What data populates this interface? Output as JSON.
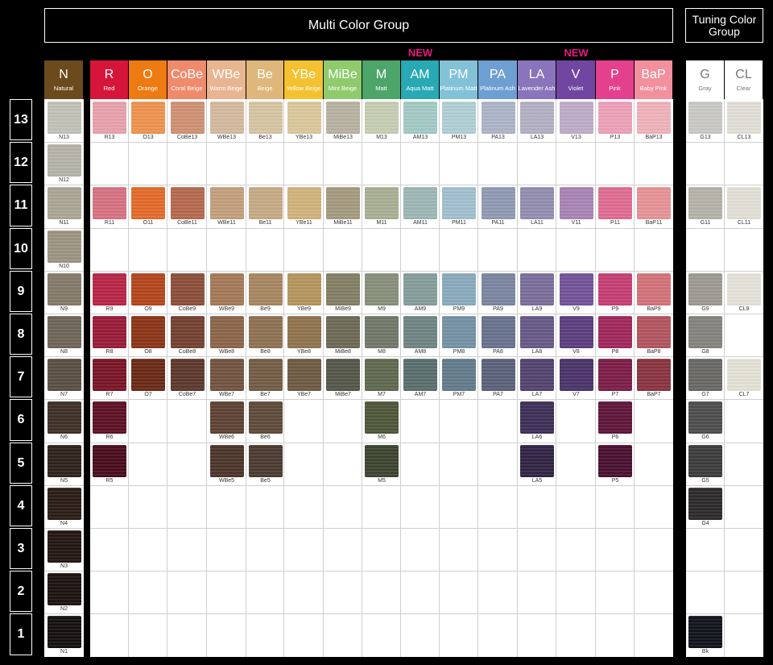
{
  "headers": {
    "multi_group": "Multi Color Group",
    "tuning_group": "Tuning Color Group",
    "new_label": "NEW"
  },
  "levels": [
    "13",
    "12",
    "11",
    "10",
    "9",
    "8",
    "7",
    "6",
    "5",
    "4",
    "3",
    "2",
    "1"
  ],
  "columns": [
    {
      "abbr": "N",
      "name": "Natural",
      "bg": "#6b4a1c"
    },
    {
      "abbr": "R",
      "name": "Red",
      "bg": "#d6153b"
    },
    {
      "abbr": "O",
      "name": "Orange",
      "bg": "#ee7a12"
    },
    {
      "abbr": "CoBe",
      "name": "Coral Beige",
      "bg": "#f08a6c"
    },
    {
      "abbr": "WBe",
      "name": "Warm Beige",
      "bg": "#e8b591"
    },
    {
      "abbr": "Be",
      "name": "Beige",
      "bg": "#dfb77a"
    },
    {
      "abbr": "YBe",
      "name": "Yellow Beige",
      "bg": "#f4c230"
    },
    {
      "abbr": "MiBe",
      "name": "Mint Beige",
      "bg": "#8fcb6c"
    },
    {
      "abbr": "M",
      "name": "Matt",
      "bg": "#4ea56a"
    },
    {
      "abbr": "AM",
      "name": "Aqua Matt",
      "bg": "#28a9b4"
    },
    {
      "abbr": "PM",
      "name": "Platinum Matt",
      "bg": "#83c2d6"
    },
    {
      "abbr": "PA",
      "name": "Platinum Ash",
      "bg": "#6e9fd2"
    },
    {
      "abbr": "LA",
      "name": "Lavender Ash",
      "bg": "#8a74bb"
    },
    {
      "abbr": "V",
      "name": "Violet",
      "bg": "#7046a1"
    },
    {
      "abbr": "P",
      "name": "Pink",
      "bg": "#e5408d"
    },
    {
      "abbr": "BaP",
      "name": "Baby Pink",
      "bg": "#f2909d"
    },
    {
      "abbr": "G",
      "name": "Gray",
      "bg": "#ffffff"
    },
    {
      "abbr": "CL",
      "name": "Clear",
      "bg": "#ffffff"
    }
  ],
  "new_columns": [
    "AM",
    "V"
  ],
  "swatches": [
    {
      "code": "N13",
      "col": 0,
      "row": 0,
      "color": "#c3c2b8"
    },
    {
      "code": "N12",
      "col": 0,
      "row": 1,
      "color": "#b6b5aa"
    },
    {
      "code": "N11",
      "col": 0,
      "row": 2,
      "color": "#aca695"
    },
    {
      "code": "N10",
      "col": 0,
      "row": 3,
      "color": "#9e9582"
    },
    {
      "code": "N9",
      "col": 0,
      "row": 4,
      "color": "#857b6b"
    },
    {
      "code": "N8",
      "col": 0,
      "row": 5,
      "color": "#6f6558"
    },
    {
      "code": "N7",
      "col": 0,
      "row": 6,
      "color": "#5b4f42"
    },
    {
      "code": "N6",
      "col": 0,
      "row": 7,
      "color": "#3e3026"
    },
    {
      "code": "N5",
      "col": 0,
      "row": 8,
      "color": "#2f231b"
    },
    {
      "code": "N4",
      "col": 0,
      "row": 9,
      "color": "#2a1c16"
    },
    {
      "code": "N3",
      "col": 0,
      "row": 10,
      "color": "#221612"
    },
    {
      "code": "N2",
      "col": 0,
      "row": 11,
      "color": "#1c1210"
    },
    {
      "code": "N1",
      "col": 0,
      "row": 12,
      "color": "#141010"
    },
    {
      "code": "R13",
      "col": 1,
      "row": 0,
      "color": "#e9a3ad"
    },
    {
      "code": "R11",
      "col": 1,
      "row": 2,
      "color": "#d87382"
    },
    {
      "code": "R9",
      "col": 1,
      "row": 4,
      "color": "#b82546"
    },
    {
      "code": "R8",
      "col": 1,
      "row": 5,
      "color": "#9a1b38"
    },
    {
      "code": "R7",
      "col": 1,
      "row": 6,
      "color": "#7a1526"
    },
    {
      "code": "R6",
      "col": 1,
      "row": 7,
      "color": "#5e1024"
    },
    {
      "code": "R5",
      "col": 1,
      "row": 8,
      "color": "#4a0c1c"
    },
    {
      "code": "O13",
      "col": 2,
      "row": 0,
      "color": "#f0944f"
    },
    {
      "code": "O11",
      "col": 2,
      "row": 2,
      "color": "#e56b2b"
    },
    {
      "code": "O9",
      "col": 2,
      "row": 4,
      "color": "#b5461c"
    },
    {
      "code": "O8",
      "col": 2,
      "row": 5,
      "color": "#8c3516"
    },
    {
      "code": "O7",
      "col": 2,
      "row": 6,
      "color": "#6a2a16"
    },
    {
      "code": "CoBe13",
      "col": 3,
      "row": 0,
      "color": "#d09275"
    },
    {
      "code": "CoBe11",
      "col": 3,
      "row": 2,
      "color": "#b66a4f"
    },
    {
      "code": "CoBe9",
      "col": 3,
      "row": 4,
      "color": "#8c4f3a"
    },
    {
      "code": "CoBe8",
      "col": 3,
      "row": 5,
      "color": "#744131"
    },
    {
      "code": "CoBe7",
      "col": 3,
      "row": 6,
      "color": "#5e382d"
    },
    {
      "code": "WBe13",
      "col": 4,
      "row": 0,
      "color": "#d5bb9f"
    },
    {
      "code": "WBe11",
      "col": 4,
      "row": 2,
      "color": "#c5a07d"
    },
    {
      "code": "WBe9",
      "col": 4,
      "row": 4,
      "color": "#a57a58"
    },
    {
      "code": "WBe8",
      "col": 4,
      "row": 5,
      "color": "#8c6549"
    },
    {
      "code": "WBe7",
      "col": 4,
      "row": 6,
      "color": "#735440"
    },
    {
      "code": "WBe6",
      "col": 4,
      "row": 7,
      "color": "#5e4233"
    },
    {
      "code": "WBe5",
      "col": 4,
      "row": 8,
      "color": "#4c352b"
    },
    {
      "code": "Be13",
      "col": 5,
      "row": 0,
      "color": "#d7c6a4"
    },
    {
      "code": "Be11",
      "col": 5,
      "row": 2,
      "color": "#c7ac86"
    },
    {
      "code": "Be9",
      "col": 5,
      "row": 4,
      "color": "#a88762"
    },
    {
      "code": "Be8",
      "col": 5,
      "row": 5,
      "color": "#8f7252"
    },
    {
      "code": "Be7",
      "col": 5,
      "row": 6,
      "color": "#755d46"
    },
    {
      "code": "Be6",
      "col": 5,
      "row": 7,
      "color": "#5f4b3a"
    },
    {
      "code": "Be5",
      "col": 5,
      "row": 8,
      "color": "#4b3b31"
    },
    {
      "code": "YBe13",
      "col": 6,
      "row": 0,
      "color": "#dcc99d"
    },
    {
      "code": "YBe11",
      "col": 6,
      "row": 2,
      "color": "#d2b47d"
    },
    {
      "code": "YBe9",
      "col": 6,
      "row": 4,
      "color": "#b5965f"
    },
    {
      "code": "YBe8",
      "col": 6,
      "row": 5,
      "color": "#90744e"
    },
    {
      "code": "YBe7",
      "col": 6,
      "row": 6,
      "color": "#6f5b44"
    },
    {
      "code": "MiBe13",
      "col": 7,
      "row": 0,
      "color": "#b9b3a2"
    },
    {
      "code": "MiBe11",
      "col": 7,
      "row": 2,
      "color": "#a59c80"
    },
    {
      "code": "MiBe9",
      "col": 7,
      "row": 4,
      "color": "#848066"
    },
    {
      "code": "MiBe8",
      "col": 7,
      "row": 5,
      "color": "#6d6b56"
    },
    {
      "code": "MiBe7",
      "col": 7,
      "row": 6,
      "color": "#56574a"
    },
    {
      "code": "M13",
      "col": 8,
      "row": 0,
      "color": "#c6cfb3"
    },
    {
      "code": "M11",
      "col": 8,
      "row": 2,
      "color": "#a9b094"
    },
    {
      "code": "M9",
      "col": 8,
      "row": 4,
      "color": "#88917b"
    },
    {
      "code": "M8",
      "col": 8,
      "row": 5,
      "color": "#71796a"
    },
    {
      "code": "M7",
      "col": 8,
      "row": 6,
      "color": "#5f6a4f"
    },
    {
      "code": "M6",
      "col": 8,
      "row": 7,
      "color": "#4e573a"
    },
    {
      "code": "M5",
      "col": 8,
      "row": 8,
      "color": "#3d4530"
    },
    {
      "code": "AM13",
      "col": 9,
      "row": 0,
      "color": "#a4cbc6"
    },
    {
      "code": "AM11",
      "col": 9,
      "row": 2,
      "color": "#9db9b6"
    },
    {
      "code": "AM9",
      "col": 9,
      "row": 4,
      "color": "#869e9c"
    },
    {
      "code": "AM8",
      "col": 9,
      "row": 5,
      "color": "#6f8684"
    },
    {
      "code": "AM7",
      "col": 9,
      "row": 6,
      "color": "#5a6f6e"
    },
    {
      "code": "PM13",
      "col": 10,
      "row": 0,
      "color": "#b1d0d6"
    },
    {
      "code": "PM11",
      "col": 10,
      "row": 2,
      "color": "#a3c0d0"
    },
    {
      "code": "PM9",
      "col": 10,
      "row": 4,
      "color": "#8aacbf"
    },
    {
      "code": "PM8",
      "col": 10,
      "row": 5,
      "color": "#7692a6"
    },
    {
      "code": "PM7",
      "col": 10,
      "row": 6,
      "color": "#637c8c"
    },
    {
      "code": "PA13",
      "col": 11,
      "row": 0,
      "color": "#adb6c8"
    },
    {
      "code": "PA11",
      "col": 11,
      "row": 2,
      "color": "#909bb4"
    },
    {
      "code": "PA9",
      "col": 11,
      "row": 4,
      "color": "#7b87a2"
    },
    {
      "code": "PA8",
      "col": 11,
      "row": 5,
      "color": "#69738e"
    },
    {
      "code": "PA7",
      "col": 11,
      "row": 6,
      "color": "#5b627a"
    },
    {
      "code": "LA13",
      "col": 12,
      "row": 0,
      "color": "#b3b1c4"
    },
    {
      "code": "LA11",
      "col": 12,
      "row": 2,
      "color": "#948fb0"
    },
    {
      "code": "LA9",
      "col": 12,
      "row": 4,
      "color": "#7b6f9c"
    },
    {
      "code": "LA8",
      "col": 12,
      "row": 5,
      "color": "#675a88"
    },
    {
      "code": "LA7",
      "col": 12,
      "row": 6,
      "color": "#544370"
    },
    {
      "code": "LA6",
      "col": 12,
      "row": 7,
      "color": "#3e2f57"
    },
    {
      "code": "LA5",
      "col": 12,
      "row": 8,
      "color": "#302443"
    },
    {
      "code": "V13",
      "col": 13,
      "row": 0,
      "color": "#bfadc9"
    },
    {
      "code": "V11",
      "col": 13,
      "row": 2,
      "color": "#a985b7"
    },
    {
      "code": "V9",
      "col": 13,
      "row": 4,
      "color": "#74549a"
    },
    {
      "code": "V8",
      "col": 13,
      "row": 5,
      "color": "#5c3e80"
    },
    {
      "code": "V7",
      "col": 13,
      "row": 6,
      "color": "#4b346a"
    },
    {
      "code": "P13",
      "col": 14,
      "row": 0,
      "color": "#eea2ba"
    },
    {
      "code": "P11",
      "col": 14,
      "row": 2,
      "color": "#e16d93"
    },
    {
      "code": "P9",
      "col": 14,
      "row": 4,
      "color": "#c73f74"
    },
    {
      "code": "P8",
      "col": 14,
      "row": 5,
      "color": "#a1275c"
    },
    {
      "code": "P7",
      "col": 14,
      "row": 6,
      "color": "#7d1d48"
    },
    {
      "code": "P6",
      "col": 14,
      "row": 7,
      "color": "#5f163a"
    },
    {
      "code": "P5",
      "col": 14,
      "row": 8,
      "color": "#4a1030"
    },
    {
      "code": "BaP13",
      "col": 15,
      "row": 0,
      "color": "#f1b3bb"
    },
    {
      "code": "BaP11",
      "col": 15,
      "row": 2,
      "color": "#e89396"
    },
    {
      "code": "BaP9",
      "col": 15,
      "row": 4,
      "color": "#d4737a"
    },
    {
      "code": "BaP8",
      "col": 15,
      "row": 5,
      "color": "#b35560"
    },
    {
      "code": "BaP7",
      "col": 15,
      "row": 6,
      "color": "#8a3441"
    },
    {
      "code": "G13",
      "col": 16,
      "row": 0,
      "color": "#cbcac4"
    },
    {
      "code": "G11",
      "col": 16,
      "row": 2,
      "color": "#b6b4aa"
    },
    {
      "code": "G9",
      "col": 16,
      "row": 4,
      "color": "#9d9b92"
    },
    {
      "code": "G8",
      "col": 16,
      "row": 5,
      "color": "#85847d"
    },
    {
      "code": "G7",
      "col": 16,
      "row": 6,
      "color": "#6a6966"
    },
    {
      "code": "G6",
      "col": 16,
      "row": 7,
      "color": "#4e4e4e"
    },
    {
      "code": "G5",
      "col": 16,
      "row": 8,
      "color": "#3c3c3d"
    },
    {
      "code": "G4",
      "col": 16,
      "row": 9,
      "color": "#2c2a2a"
    },
    {
      "code": "Bk",
      "col": 16,
      "row": 12,
      "color": "#11141c"
    },
    {
      "code": "CL13",
      "col": 17,
      "row": 0,
      "color": "#e2e0d8"
    },
    {
      "code": "CL11",
      "col": 17,
      "row": 2,
      "color": "#e3e1d7"
    },
    {
      "code": "CL9",
      "col": 17,
      "row": 4,
      "color": "#e5e3da"
    },
    {
      "code": "CL7",
      "col": 17,
      "row": 6,
      "color": "#e6e3d8"
    }
  ]
}
